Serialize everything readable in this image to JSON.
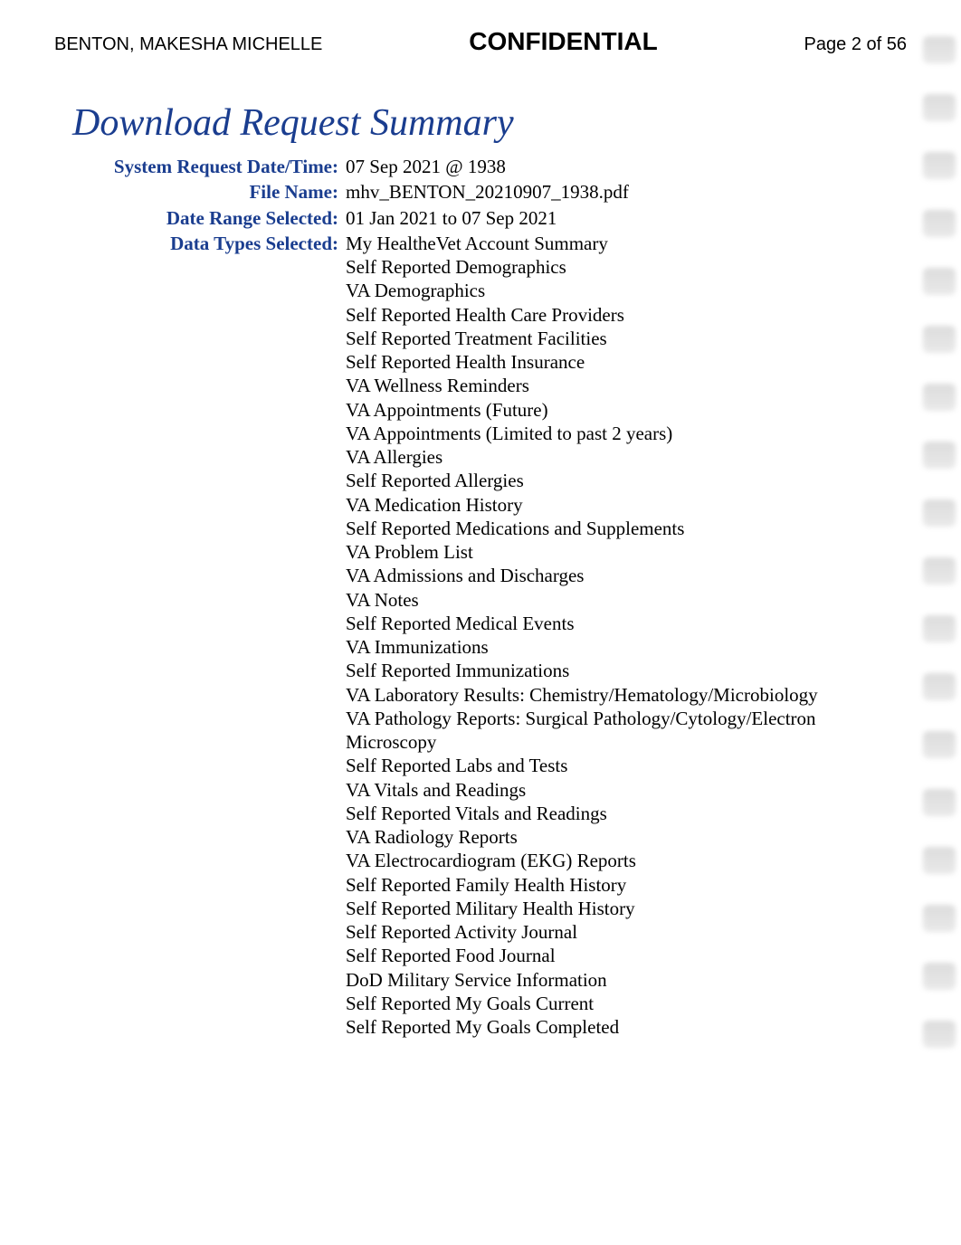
{
  "header": {
    "patient_name": "BENTON, MAKESHA MICHELLE",
    "confidential": "CONFIDENTIAL",
    "page_indicator": "Page 2 of 56"
  },
  "section_title": "Download Request Summary",
  "summary": {
    "rows": [
      {
        "label": "System Request Date/Time:",
        "value": "07 Sep 2021 @ 1938"
      },
      {
        "label": "File Name:",
        "value": "mhv_BENTON_20210907_1938.pdf"
      },
      {
        "label": "Date Range Selected:",
        "value": "01 Jan 2021 to 07 Sep 2021"
      }
    ],
    "data_types_label": "Data Types Selected:",
    "data_types": [
      "My HealtheVet Account Summary",
      "Self Reported Demographics",
      "VA Demographics",
      "Self Reported Health Care Providers",
      "Self Reported Treatment Facilities",
      "Self Reported Health Insurance",
      "VA Wellness Reminders",
      "VA Appointments (Future)",
      "VA Appointments (Limited to past 2 years)",
      "VA Allergies",
      "Self Reported Allergies",
      "VA Medication History",
      "Self Reported Medications and Supplements",
      "VA Problem List",
      "VA Admissions and Discharges",
      "VA Notes",
      "Self Reported Medical Events",
      "VA Immunizations",
      "Self Reported Immunizations",
      "VA Laboratory Results: Chemistry/Hematology/Microbiology",
      "VA Pathology Reports: Surgical Pathology/Cytology/Electron Microscopy",
      "Self Reported Labs and Tests",
      "VA Vitals and Readings",
      "Self Reported Vitals and Readings",
      "VA Radiology Reports",
      "VA Electrocardiogram (EKG) Reports",
      "Self Reported Family Health History",
      "Self Reported Military Health History",
      "Self Reported Activity Journal",
      "Self Reported Food Journal",
      "DoD Military Service Information",
      "Self Reported My Goals Current",
      "Self Reported My Goals Completed"
    ]
  }
}
